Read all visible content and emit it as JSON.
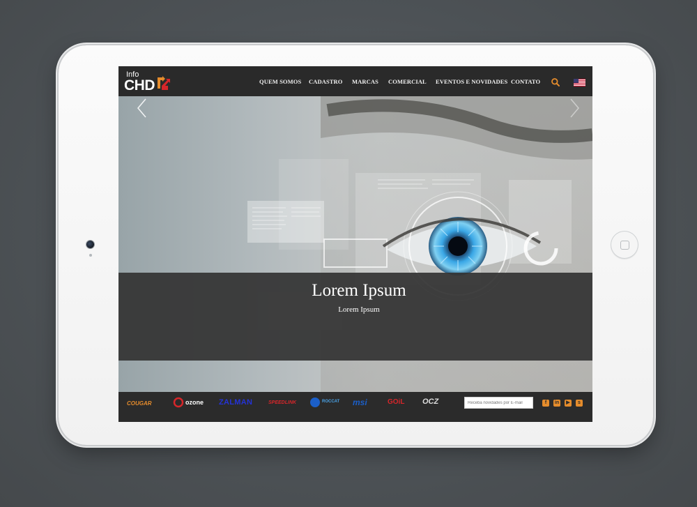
{
  "header": {
    "logo_info": "Info",
    "logo_chd": "CHD",
    "nav": [
      "QUEM SOMOS",
      "CADASTRO",
      "MARCAS",
      "COMERCIAL",
      "EVENTOS E NOVIDADES",
      "CONTATO"
    ],
    "search_icon": "search-icon",
    "language_flag": "us-flag-icon"
  },
  "hero": {
    "title": "Lorem Ipsum",
    "subtitle": "Lorem Ipsum",
    "prev_icon": "chevron-left-icon",
    "next_icon": "chevron-right-icon"
  },
  "footer": {
    "brands": [
      "COUGAR",
      "ozone",
      "ZALMAN",
      "SPEEDLINK",
      "ROCCAT",
      "msi",
      "GOiL",
      "OCZ"
    ],
    "newsletter_placeholder": "Receba novidades por E-mail",
    "social": [
      "facebook-icon",
      "linkedin-icon",
      "youtube-icon",
      "skype-icon"
    ]
  },
  "colors": {
    "accent": "#e58c2c",
    "header_bg": "#2a2a2a",
    "caption_band": "#343434",
    "zalman_blue": "#2433d6",
    "msi_blue": "#1b5fc9",
    "goil_red": "#d6262a"
  }
}
